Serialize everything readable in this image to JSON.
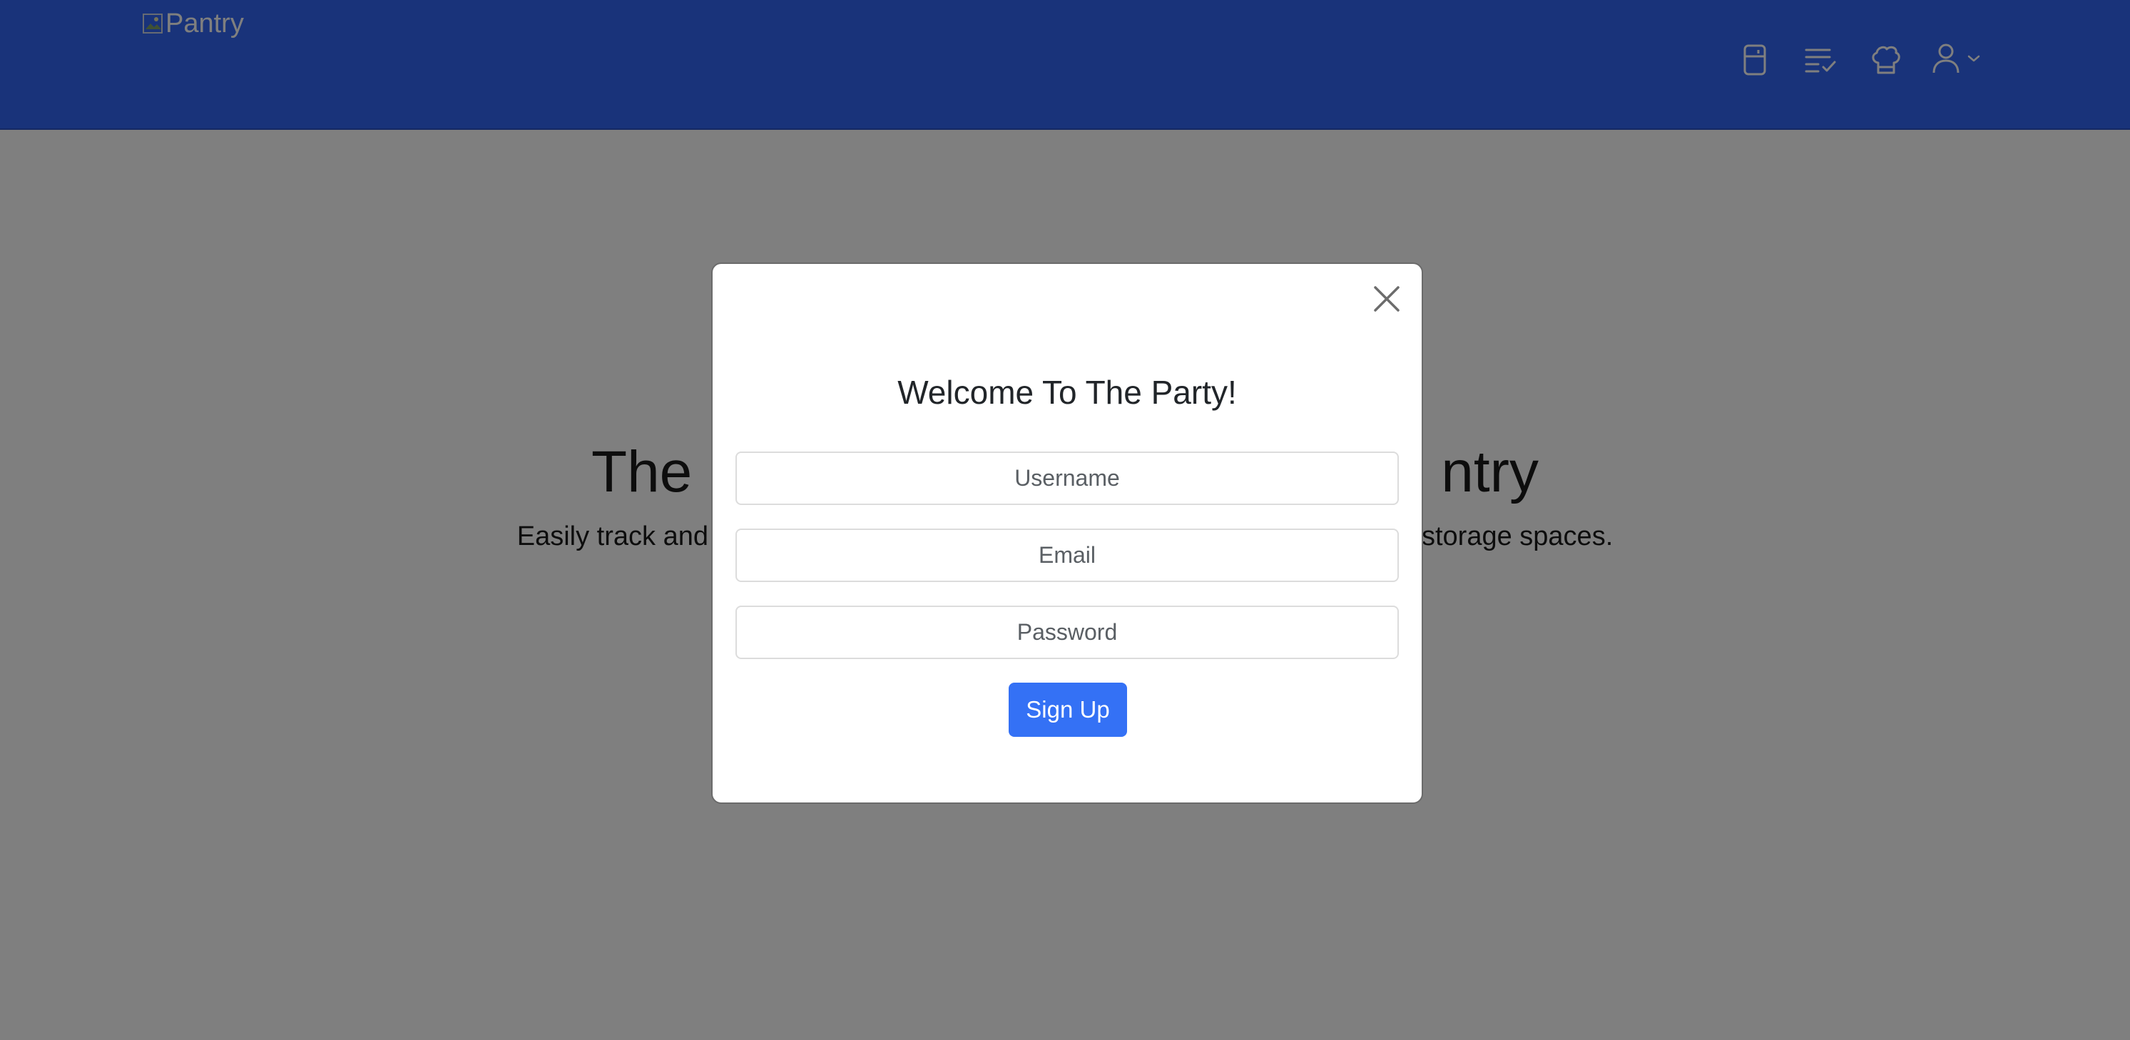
{
  "navbar": {
    "brand_alt": "Pantry",
    "icons": [
      "fridge-icon",
      "checklist-icon",
      "chef-hat-icon",
      "user-icon",
      "chevron-down-icon"
    ]
  },
  "hero": {
    "title_left": "The",
    "title_right": "ntry",
    "subtitle_left": "Easily track and",
    "subtitle_right": "storage spaces."
  },
  "modal": {
    "title": "Welcome To The Party!",
    "username_placeholder": "Username",
    "email_placeholder": "Email",
    "password_placeholder": "Password",
    "submit_label": "Sign Up"
  },
  "colors": {
    "navbar_bg": "#3367f5",
    "button_bg": "#3471f5",
    "overlay": "rgba(0,0,0,0.5)"
  }
}
